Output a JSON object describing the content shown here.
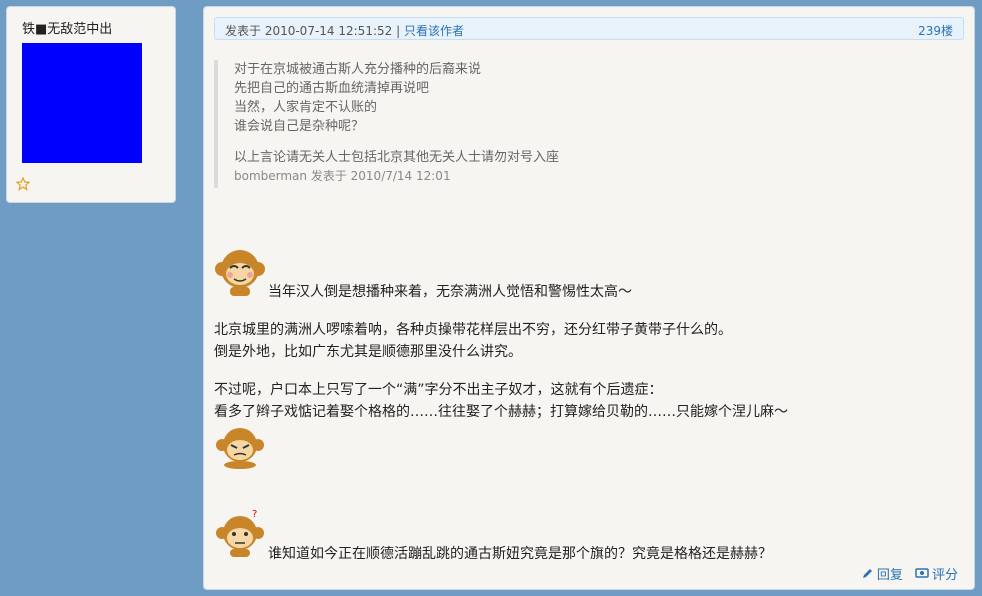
{
  "user": {
    "name": "铁■无敌范中出",
    "avatar_color": "#0000ff",
    "star_icon": "star-outline-icon"
  },
  "post": {
    "header": {
      "posted_prefix": "发表于 2010-07-14 12:51:52 | ",
      "only_author": "只看该作者",
      "floor": "239楼"
    },
    "quote": {
      "lines": [
        "对于在京城被通古斯人充分播种的后裔来说",
        "先把自己的通古斯血统清掉再说吧",
        "当然，人家肯定不认账的",
        "谁会说自己是杂种呢？"
      ],
      "note": "以上言论请无关人士包括北京其他无关人士请勿对号入座",
      "signature": "bomberman 发表于 2010/7/14 12:01"
    },
    "body": {
      "line1": "当年汉人倒是想播种来着，无奈满洲人觉悟和警惕性太高～",
      "line2": "北京城里的满洲人啰嗦着呐，各种贞操带花样层出不穷，还分红带子黄带子什么的。",
      "line3": "倒是外地，比如广东尤其是顺德那里没什么讲究。",
      "line4": "不过呢，户口本上只写了一个“满”字分不出主子奴才，这就有个后遗症：",
      "line5": "看多了辫子戏惦记着娶个格格的……往往娶了个赫赫；打算嫁给贝勒的……只能嫁个涅儿麻～",
      "line6": "谁知道如今正在顺德活蹦乱跳的通古斯妞究竟是那个旗的？究竟是格格还是赫赫？"
    },
    "footer": {
      "reply": "回复",
      "rate": "评分"
    }
  }
}
